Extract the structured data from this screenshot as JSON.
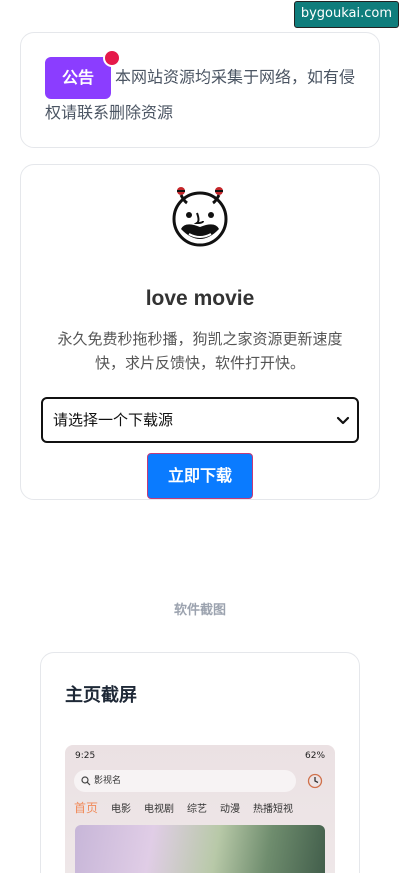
{
  "site_tag": "bygoukai.com",
  "notice": {
    "badge": "公告",
    "text": "本网站资源均采集于网络，如有侵权请联系删除资源"
  },
  "app": {
    "name": "love movie",
    "description": "永久免费秒拖秒播，狗凯之家资源更新速度快，求片反馈快，软件打开快。",
    "select_value": "请选择一个下载源",
    "download_label": "立即下载"
  },
  "screenshots": {
    "section_title": "软件截图",
    "card_title": "主页截屏",
    "phone": {
      "time": "9:25",
      "battery": "62",
      "search_placeholder": "影视名",
      "tabs": [
        "首页",
        "电影",
        "电视剧",
        "综艺",
        "动漫",
        "热播短视"
      ]
    }
  },
  "colors": {
    "notice_badge": "#8b3dff",
    "download_button": "#0a7bff",
    "site_tag": "#0f7d7c",
    "active_tab": "#f08a5a"
  }
}
